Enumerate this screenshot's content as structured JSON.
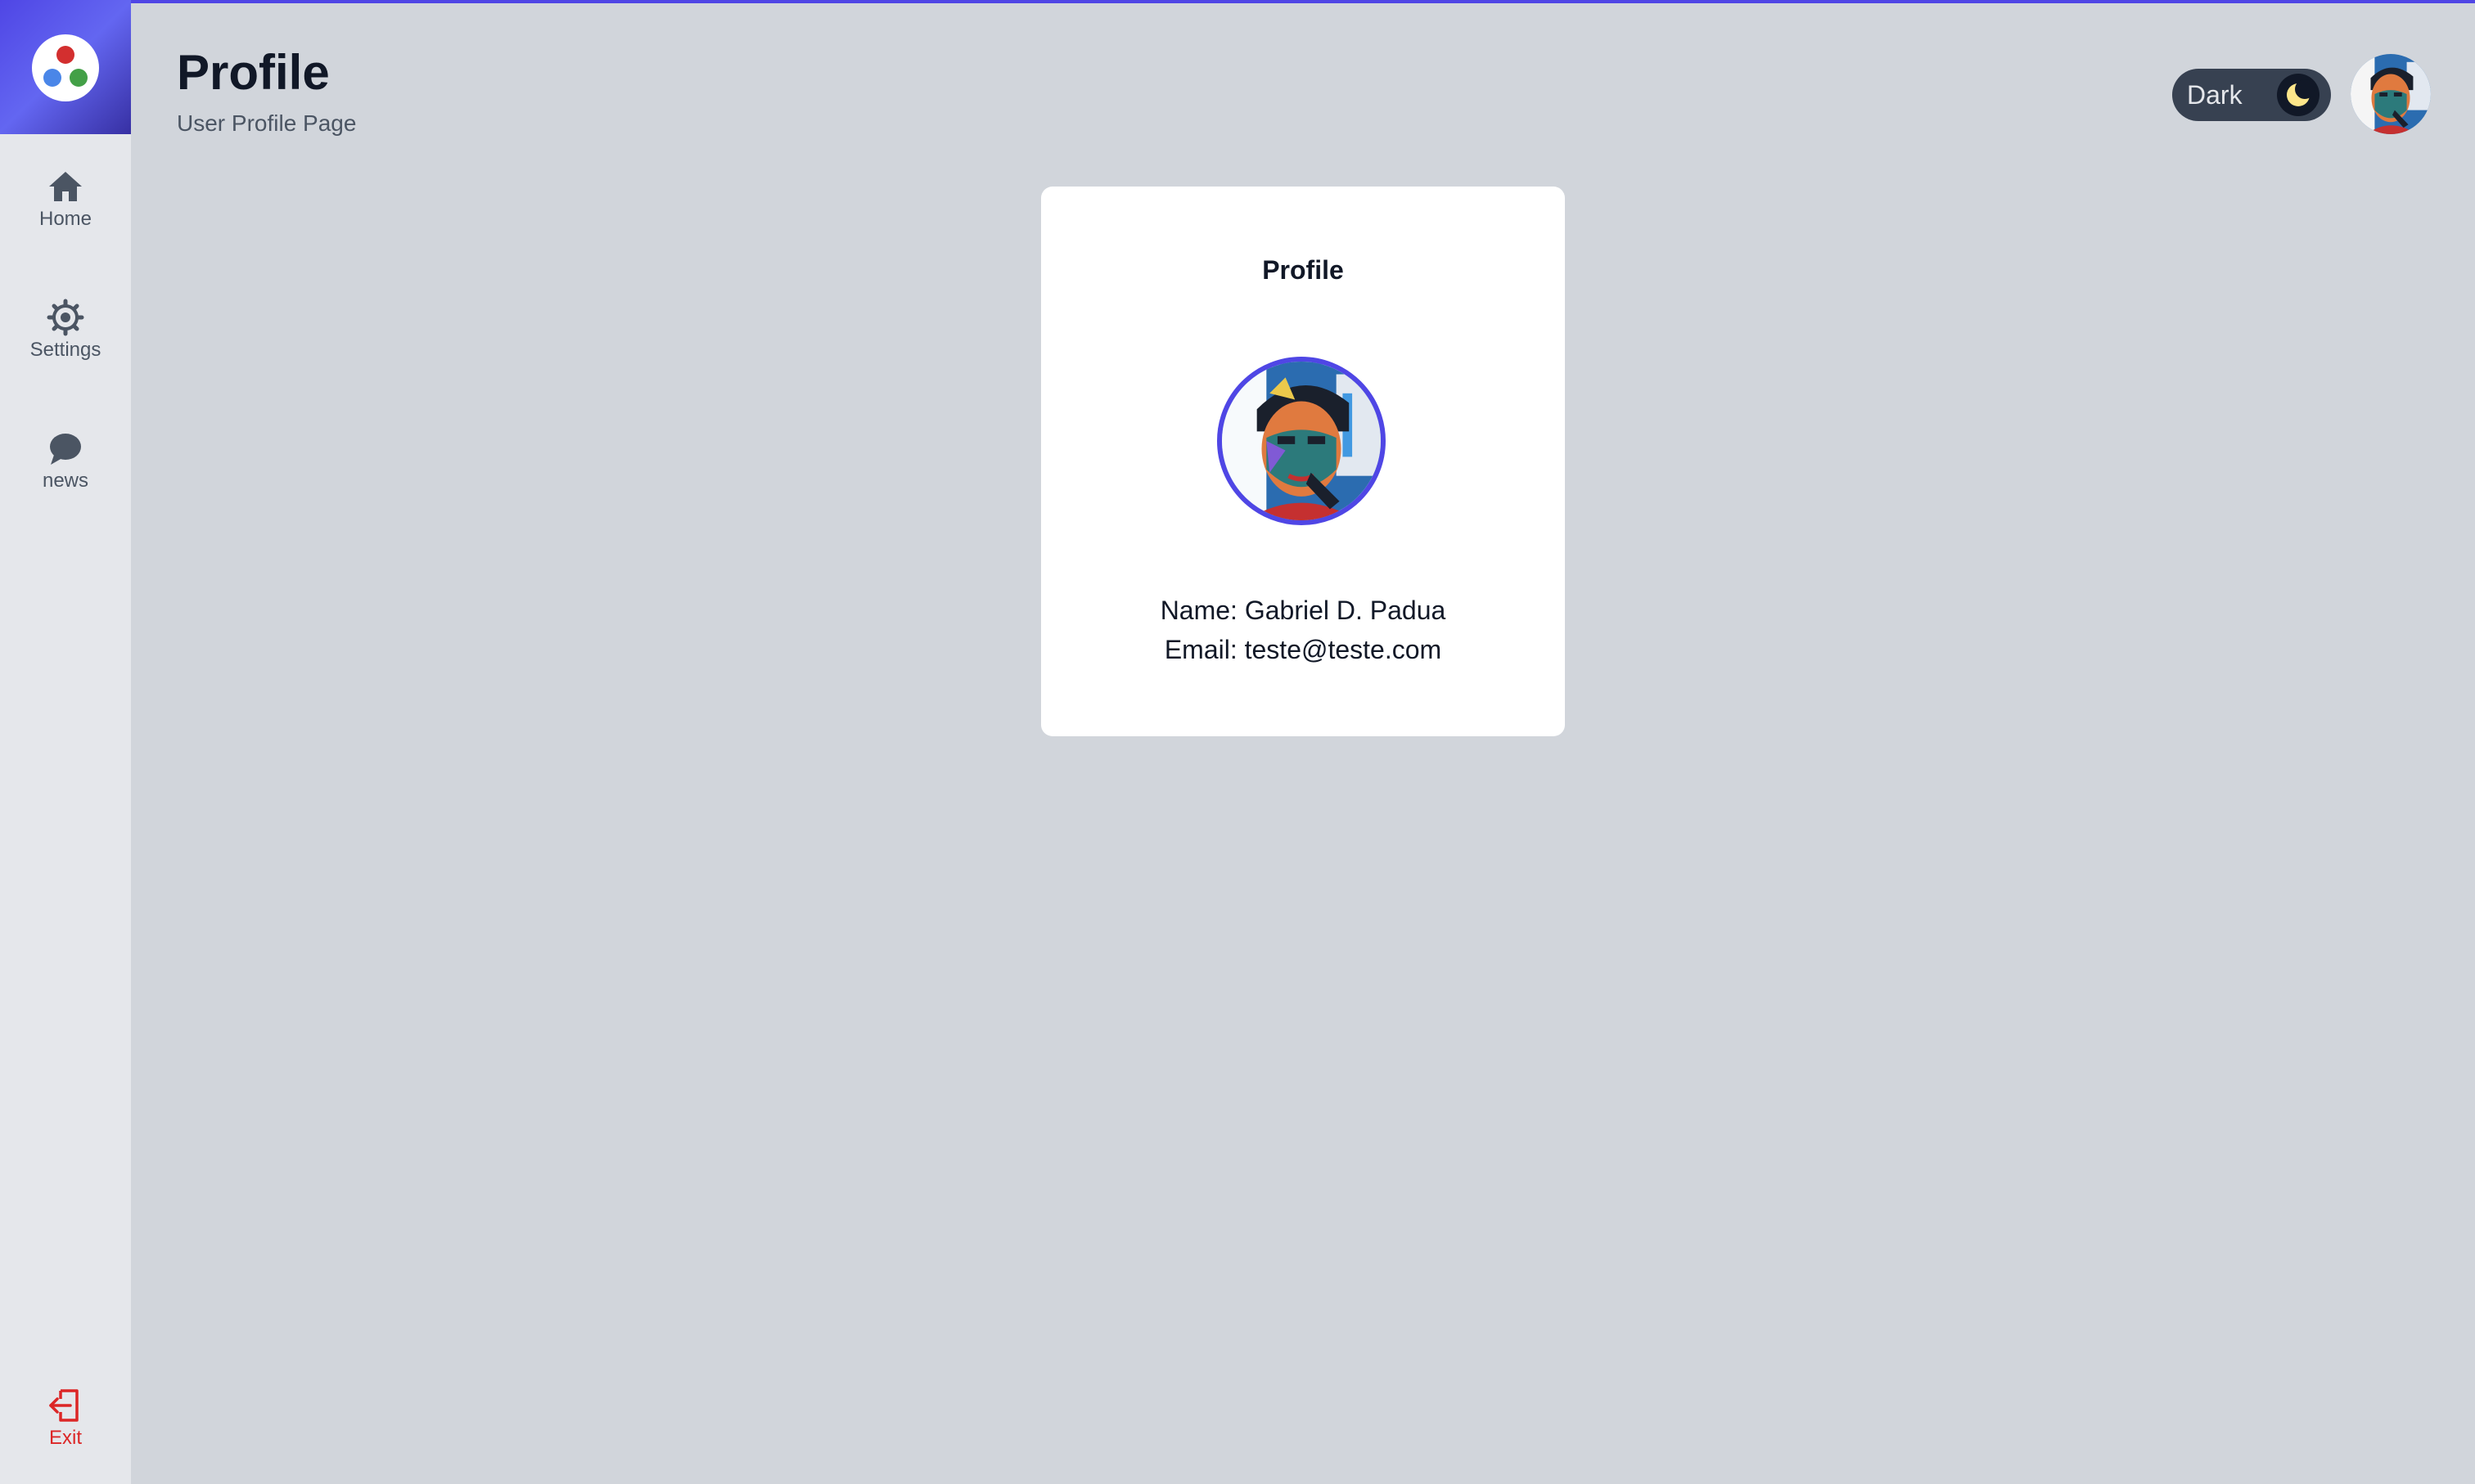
{
  "header": {
    "title": "Profile",
    "subtitle": "User Profile Page"
  },
  "sidebar": {
    "logo": "app-logo",
    "items": [
      {
        "label": "Home",
        "icon": "home-icon"
      },
      {
        "label": "Settings",
        "icon": "gear-icon"
      },
      {
        "label": "news",
        "icon": "chat-bubble-icon"
      }
    ],
    "exit": {
      "label": "Exit",
      "icon": "exit-icon",
      "color": "#dc2626"
    }
  },
  "theme_toggle": {
    "label": "Dark",
    "icon": "moon-icon"
  },
  "profile_card": {
    "title": "Profile",
    "name_text": "Name: Gabriel D. Padua",
    "email_text": "Email: teste@teste.com"
  },
  "colors": {
    "accent": "#4f46e5",
    "background": "#d1d5db",
    "sidebar": "#e5e7eb",
    "card": "#ffffff",
    "toggle": "#374151",
    "moon": "#fde68a"
  }
}
